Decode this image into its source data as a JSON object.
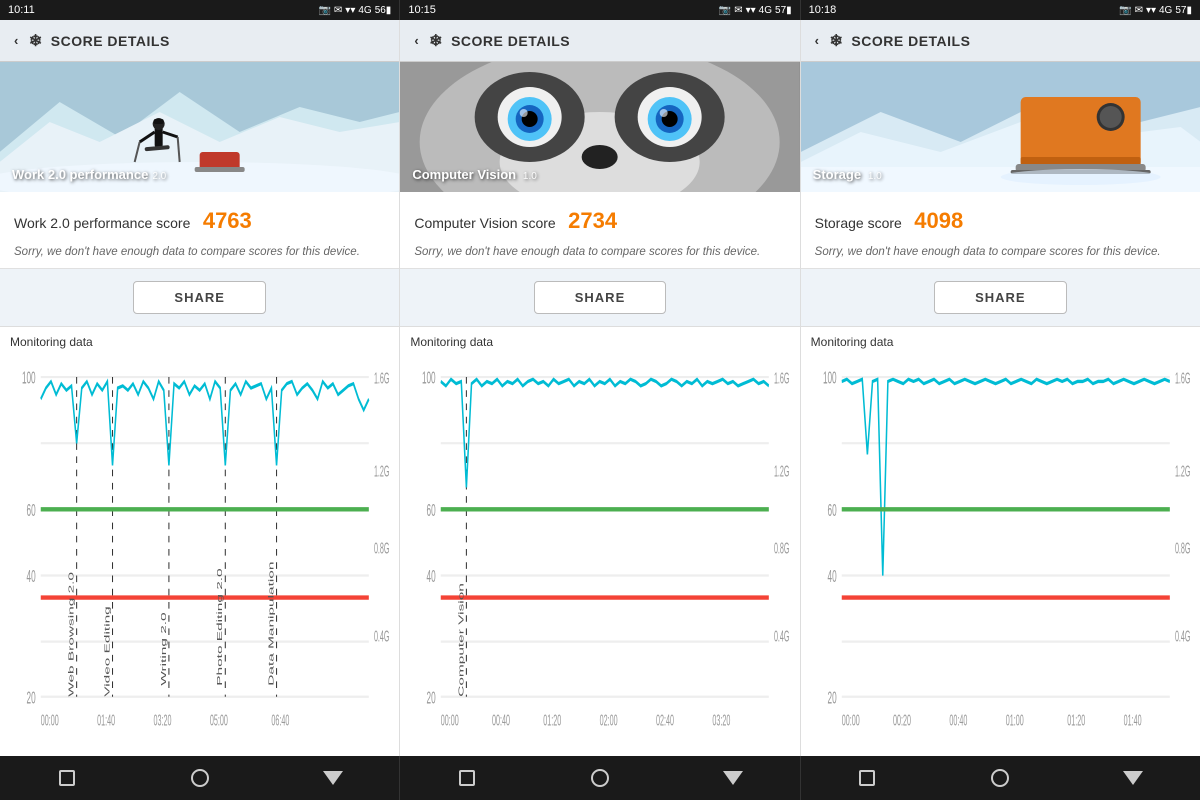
{
  "statusBars": [
    {
      "time": "10:11",
      "icons": "📷 ✉",
      "battery": "56"
    },
    {
      "time": "10:15",
      "icons": "📷 ✉",
      "battery": "57"
    },
    {
      "time": "10:18",
      "icons": "📷 ✉",
      "battery": "57"
    }
  ],
  "panels": [
    {
      "id": "work",
      "headerLabel": "SCORE DETAILS",
      "heroLabel": "Work 2.0 performance",
      "heroVersion": "2.0",
      "scoreTitle": "Work 2.0 performance score",
      "scoreValue": "4763",
      "note": "Sorry, we don't have enough data to compare scores for this device.",
      "shareLabel": "SHARE",
      "monitoringLabel": "Monitoring data",
      "chartLines": [
        {
          "label": "Web Browsing 2.0",
          "x": 15
        },
        {
          "label": "Video Editing",
          "x": 30
        },
        {
          "label": "Writing 2.0",
          "x": 50
        },
        {
          "label": "Photo Editing 2.0",
          "x": 70
        },
        {
          "label": "Data Manipulation",
          "x": 88
        }
      ]
    },
    {
      "id": "cv",
      "headerLabel": "SCORE DETAILS",
      "heroLabel": "Computer Vision",
      "heroVersion": "1.0",
      "scoreTitle": "Computer Vision score",
      "scoreValue": "2734",
      "note": "Sorry, we don't have enough data to compare scores for this device.",
      "shareLabel": "SHARE",
      "monitoringLabel": "Monitoring data",
      "chartLines": [
        {
          "label": "Computer Vision",
          "x": 10
        }
      ]
    },
    {
      "id": "storage",
      "headerLabel": "SCORE DETAILS",
      "heroLabel": "Storage",
      "heroVersion": "1.0",
      "scoreTitle": "Storage score",
      "scoreValue": "4098",
      "note": "Sorry, we don't have enough data to compare scores for this device.",
      "shareLabel": "SHARE",
      "monitoringLabel": "Monitoring data",
      "chartLines": []
    }
  ],
  "nav": {
    "items": [
      "square",
      "circle",
      "triangle"
    ]
  }
}
